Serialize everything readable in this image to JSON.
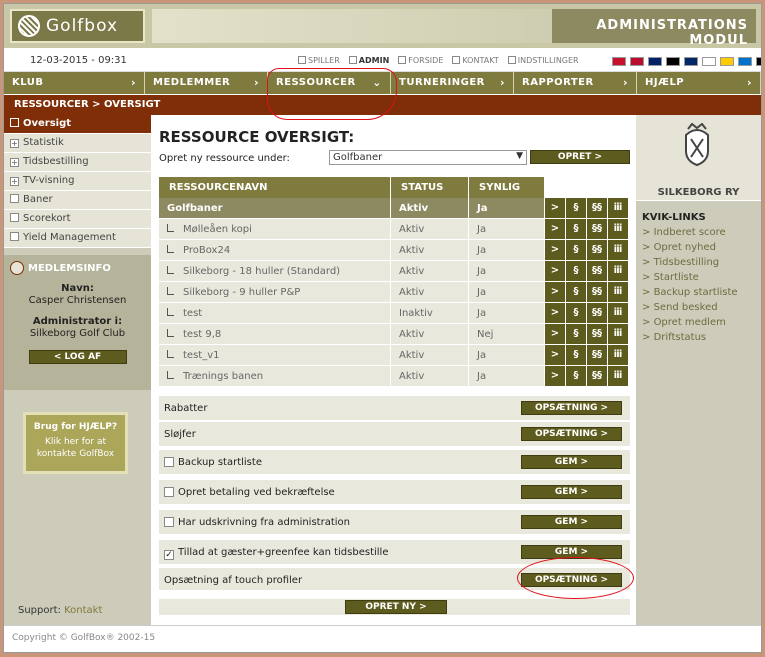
{
  "header": {
    "logo_text": "Golfbox",
    "banner": "ADMINISTRATIONS MODUL"
  },
  "util": {
    "datetime": "12-03-2015 - 09:31",
    "links": [
      "SPILLER",
      "ADMIN",
      "FORSIDE",
      "KONTAKT",
      "INDSTILLINGER"
    ],
    "active": "ADMIN",
    "flag_colors": [
      "#c8102e",
      "#ba0c2f",
      "#012169",
      "#000000",
      "#002868",
      "#ffffff",
      "#fecb00",
      "#0072ce",
      "#000000"
    ]
  },
  "nav": {
    "items": [
      "KLUB",
      "MEDLEMMER",
      "RESSOURCER",
      "TURNERINGER",
      "RAPPORTER",
      "HJÆLP"
    ]
  },
  "breadcrumb": "RESSOURCER > OVERSIGT",
  "sidebar": {
    "items": [
      {
        "label": "Oversigt",
        "marker": ""
      },
      {
        "label": "Statistik",
        "marker": "+"
      },
      {
        "label": "Tidsbestilling",
        "marker": "+"
      },
      {
        "label": "TV-visning",
        "marker": "+"
      },
      {
        "label": "Baner",
        "marker": ""
      },
      {
        "label": "Scorekort",
        "marker": ""
      },
      {
        "label": "Yield Management",
        "marker": ""
      }
    ]
  },
  "member": {
    "header": "MEDLEMSINFO",
    "name_label": "Navn:",
    "name": "Casper Christensen",
    "admin_label": "Administrator i:",
    "club": "Silkeborg Golf Club",
    "logout": "< LOG AF"
  },
  "help": {
    "title": "Brug for HJÆLP?",
    "text": "Klik her for at kontakte GolfBox"
  },
  "support": {
    "label": "Support:",
    "link": "Kontakt"
  },
  "main": {
    "title": "RESSOURCE OVERSIGT:",
    "create_label": "Opret ny ressource under:",
    "select_value": "Golfbaner",
    "create_button": "OPRET >",
    "columns": [
      "RESSOURCENAVN",
      "STATUS",
      "SYNLIG"
    ],
    "group": {
      "name": "Golfbaner",
      "status": "Aktiv",
      "visible": "Ja"
    },
    "rows": [
      {
        "name": "Mølleåen kopi",
        "status": "Aktiv",
        "visible": "Ja"
      },
      {
        "name": "ProBox24",
        "status": "Aktiv",
        "visible": "Ja"
      },
      {
        "name": "Silkeborg - 18 huller (Standard)",
        "status": "Aktiv",
        "visible": "Ja"
      },
      {
        "name": "Silkeborg - 9 huller P&P",
        "status": "Aktiv",
        "visible": "Ja"
      },
      {
        "name": "test",
        "status": "Inaktiv",
        "visible": "Ja"
      },
      {
        "name": "test 9,8",
        "status": "Aktiv",
        "visible": "Nej"
      },
      {
        "name": "test_v1",
        "status": "Aktiv",
        "visible": "Ja"
      },
      {
        "name": "Trænings banen",
        "status": "Aktiv",
        "visible": "Ja"
      }
    ],
    "action_glyphs": [
      ">",
      "§",
      "§§",
      "ⅲ"
    ],
    "options": [
      {
        "label": "Rabatter",
        "checkbox": false,
        "checked": false,
        "button": "OPSÆTNING >"
      },
      {
        "label": "Sløjfer",
        "checkbox": false,
        "checked": false,
        "button": "OPSÆTNING >"
      },
      {
        "label": "Backup startliste",
        "checkbox": true,
        "checked": false,
        "button": "GEM >"
      },
      {
        "label": "Opret betaling ved bekræftelse",
        "checkbox": true,
        "checked": false,
        "button": "GEM >"
      },
      {
        "label": "Har udskrivning fra administration",
        "checkbox": true,
        "checked": false,
        "button": "GEM >"
      },
      {
        "label": "Tillad at gæster+greenfee kan tidsbestille",
        "checkbox": true,
        "checked": true,
        "button": "GEM >"
      },
      {
        "label": "Opsætning af touch profiler",
        "checkbox": false,
        "checked": false,
        "button": "OPSÆTNING >"
      }
    ],
    "bottom_button": "OPRET NY >"
  },
  "right": {
    "club_name": "SILKEBORG RY",
    "kvik_title": "KVIK-LINKS",
    "links": [
      "Indberet score",
      "Opret nyhed",
      "Tidsbestilling",
      "Startliste",
      "Backup startliste",
      "Send besked",
      "Opret medlem",
      "Driftstatus"
    ]
  },
  "footer": {
    "copyright": "Copyright © GolfBox® 2002-15"
  }
}
